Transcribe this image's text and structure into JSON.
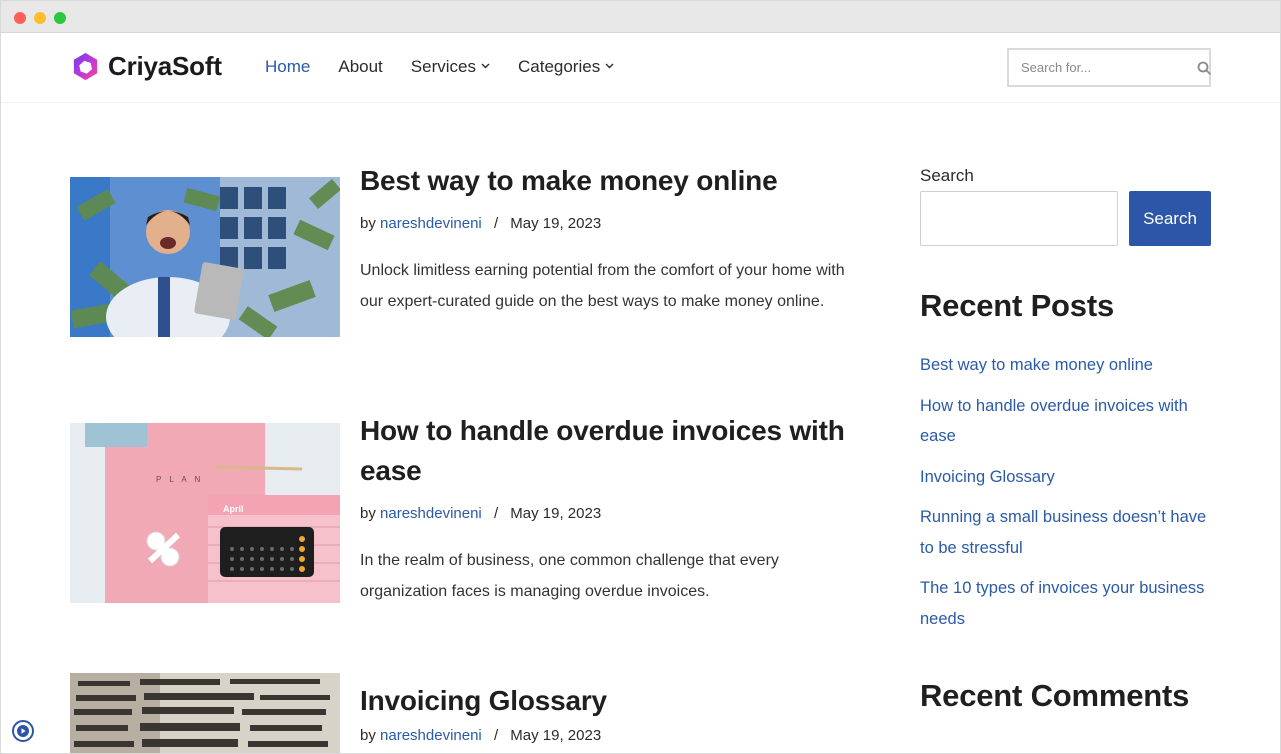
{
  "brand": {
    "name": "CriyaSoft",
    "accent": "#2a5aa8",
    "button_color": "#2e56a8"
  },
  "nav": {
    "items": [
      {
        "label": "Home",
        "active": true
      },
      {
        "label": "About"
      },
      {
        "label": "Services",
        "dropdown": true
      },
      {
        "label": "Categories",
        "dropdown": true
      }
    ]
  },
  "header_search": {
    "placeholder": "Search for..."
  },
  "posts": [
    {
      "title": "Best way to make money online",
      "by": "by",
      "author": "nareshdevineni",
      "separator": "/",
      "date": "May 19, 2023",
      "excerpt": "Unlock limitless earning potential from the comfort of your home with our expert-curated guide on the best ways to make money online."
    },
    {
      "title": "How to handle overdue invoices with ease",
      "by": "by",
      "author": "nareshdevineni",
      "separator": "/",
      "date": "May 19, 2023",
      "excerpt": "In the realm of business, one common challenge that every organization faces is managing overdue invoices.",
      "image_text": {
        "month": "April",
        "letters": "P L A N"
      }
    },
    {
      "title": "Invoicing Glossary",
      "by": "by",
      "author": "nareshdevineni",
      "separator": "/",
      "date": "May 19, 2023"
    }
  ],
  "sidebar": {
    "search_label": "Search",
    "search_button": "Search",
    "recent_posts_heading": "Recent Posts",
    "recent_posts": [
      "Best way to make money online",
      "How to handle overdue invoices with ease",
      "Invoicing Glossary",
      "Running a small business doesn’t have to be stressful",
      "The 10 types of invoices your business needs"
    ],
    "recent_comments_heading": "Recent Comments"
  }
}
